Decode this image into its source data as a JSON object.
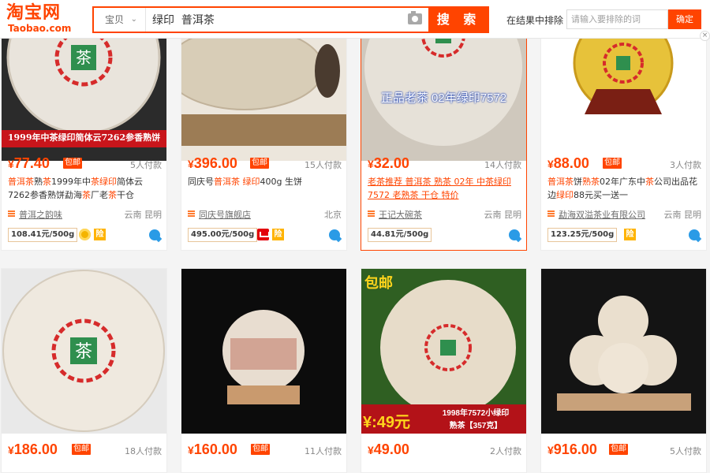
{
  "header": {
    "logo_cn": "淘宝网",
    "logo_en": "Taobao.com",
    "search_type": "宝贝",
    "query": "绿印  普洱茶",
    "search_button": "搜 索",
    "exclude_label": "在结果中排除",
    "exclude_placeholder": "请输入要排除的词",
    "confirm_button": "确定"
  },
  "icons": [
    "camera-icon",
    "shop-icon",
    "gold-seller-icon",
    "guarantee-icon",
    "tmall-icon",
    "wangwang-icon",
    "close-icon",
    "chevron-down-icon"
  ],
  "colors": {
    "brand": "#ff4400",
    "price": "#ff4400",
    "link_blue": "#2a9be6"
  },
  "items": [
    {
      "caption": "1999年中茶绿印简体云7262参香熟饼",
      "price": "77.40",
      "badge": "包邮",
      "sales": "5人付款",
      "title": [
        {
          "t": "普洱茶",
          "h": true
        },
        {
          "t": "熟"
        },
        {
          "t": "茶",
          "h": true
        },
        {
          "t": "1999年中"
        },
        {
          "t": "茶绿印",
          "h": true
        },
        {
          "t": "简体云7262参香熟饼勐海"
        },
        {
          "t": "茶",
          "h": true
        },
        {
          "t": "厂老"
        },
        {
          "t": "茶",
          "h": true
        },
        {
          "t": "干仓"
        }
      ],
      "shop": "普洱之韵味",
      "location": "云南 昆明",
      "unit_price": "108.41元/500g",
      "badges": [
        "gold-seller-icon",
        "guarantee-icon"
      ]
    },
    {
      "caption": "",
      "price": "396.00",
      "badge": "包邮",
      "sales": "15人付款",
      "title": [
        {
          "t": "同庆号"
        },
        {
          "t": "普洱茶",
          "h": true
        },
        {
          "t": " "
        },
        {
          "t": "绿印",
          "h": true
        },
        {
          "t": "400g 生饼"
        }
      ],
      "shop": "同庆号旗舰店",
      "location": "北京",
      "unit_price": "495.00元/500g",
      "badges": [
        "tmall-icon",
        "guarantee-icon"
      ]
    },
    {
      "caption": "正品老茶 02年绿印7572",
      "price": "32.00",
      "badge": "",
      "sales": "14人付款",
      "title": [
        {
          "t": "老茶推荐 普洱茶 熟茶 02年 中茶绿印 7572 老熟茶 干仓 特价"
        }
      ],
      "shop": "王记大碗茶",
      "location": "云南 昆明",
      "unit_price": "44.81元/500g",
      "badges": []
    },
    {
      "caption": "",
      "price": "88.00",
      "badge": "包邮",
      "sales": "3人付款",
      "title": [
        {
          "t": "普洱茶",
          "h": true
        },
        {
          "t": "饼"
        },
        {
          "t": "熟茶",
          "h": true
        },
        {
          "t": "02年广东中"
        },
        {
          "t": "茶",
          "h": true
        },
        {
          "t": "公司出品花边"
        },
        {
          "t": "绿印",
          "h": true
        },
        {
          "t": "88元买一送一"
        }
      ],
      "shop": "勐海双溢茶业有限公司",
      "location": "云南 昆明",
      "unit_price": "123.25元/500g",
      "badges": [
        "guarantee-icon"
      ]
    },
    {
      "caption": "",
      "price": "186.00",
      "badge": "包邮",
      "sales": "18人付款"
    },
    {
      "caption": "",
      "price": "160.00",
      "badge": "包邮",
      "sales": "11人付款"
    },
    {
      "caption_top": "包邮",
      "caption_price": "¥:49元",
      "caption_line1": "1998年7572小绿印",
      "caption_line2": "熟茶【357克】",
      "price": "49.00",
      "badge": "",
      "sales": "2人付款"
    },
    {
      "caption": "",
      "price": "916.00",
      "badge": "包邮",
      "sales": "5人付款"
    }
  ],
  "status_url": "taobao.com?id=3…377&nd…#detail"
}
